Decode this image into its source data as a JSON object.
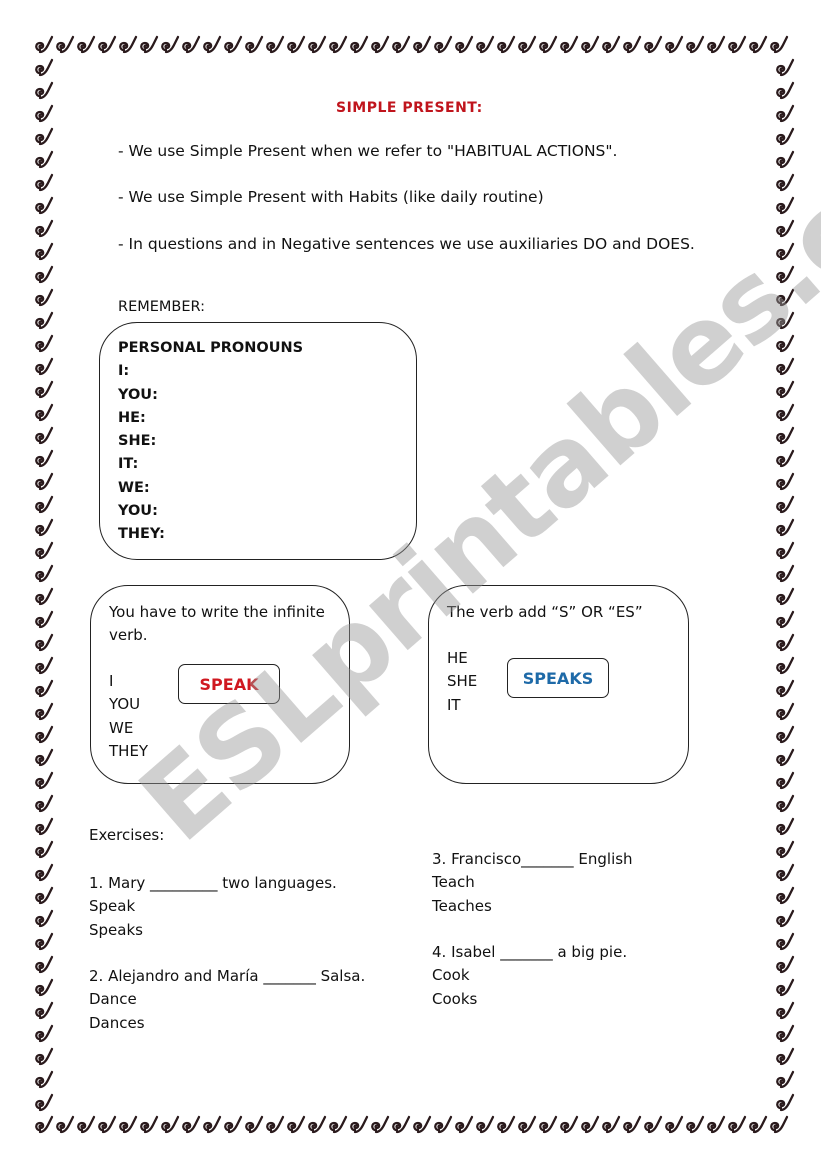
{
  "worksheet": {
    "title": "SIMPLE PRESENT:",
    "rules": [
      "-   We use Simple Present when we refer to \"HABITUAL ACTIONS\".",
      "- We use Simple Present with Habits (like daily routine)",
      "- In questions and in Negative sentences we use auxiliaries DO and DOES."
    ],
    "remember_label": "REMEMBER:",
    "pronouns_box": {
      "heading": "PERSONAL PRONOUNS",
      "items": [
        "I:",
        "YOU:",
        "HE:",
        "SHE:",
        "IT:",
        "WE:",
        "YOU:",
        "THEY:"
      ]
    },
    "infinitive_box": {
      "note": "You have to write the infinite verb.",
      "subjects": [
        "I",
        "YOU",
        "WE",
        "THEY"
      ],
      "verb": "SPEAK",
      "verb_color": "#d01820"
    },
    "third_person_box": {
      "note": "The verb add “S” OR “ES”",
      "subjects": [
        "HE",
        "SHE",
        "IT"
      ],
      "verb": "SPEAKS",
      "verb_color": "#1e6aa8"
    },
    "exercises_label": "Exercises:",
    "exercises": [
      {
        "sentence": "1. Mary _________ two languages.",
        "options": [
          "Speak",
          "Speaks"
        ]
      },
      {
        "sentence": "2. Alejandro and María _______ Salsa.",
        "options": [
          "Dance",
          "Dances"
        ]
      },
      {
        "sentence": "3. Francisco_______ English",
        "options": [
          "Teach",
          "Teaches"
        ]
      },
      {
        "sentence": "4. Isabel _______ a big pie.",
        "options": [
          "Cook",
          "Cooks"
        ]
      }
    ],
    "watermark": "ESLprintables.com",
    "title_color": "#c0141c",
    "border_icon": "swirl-icon"
  }
}
